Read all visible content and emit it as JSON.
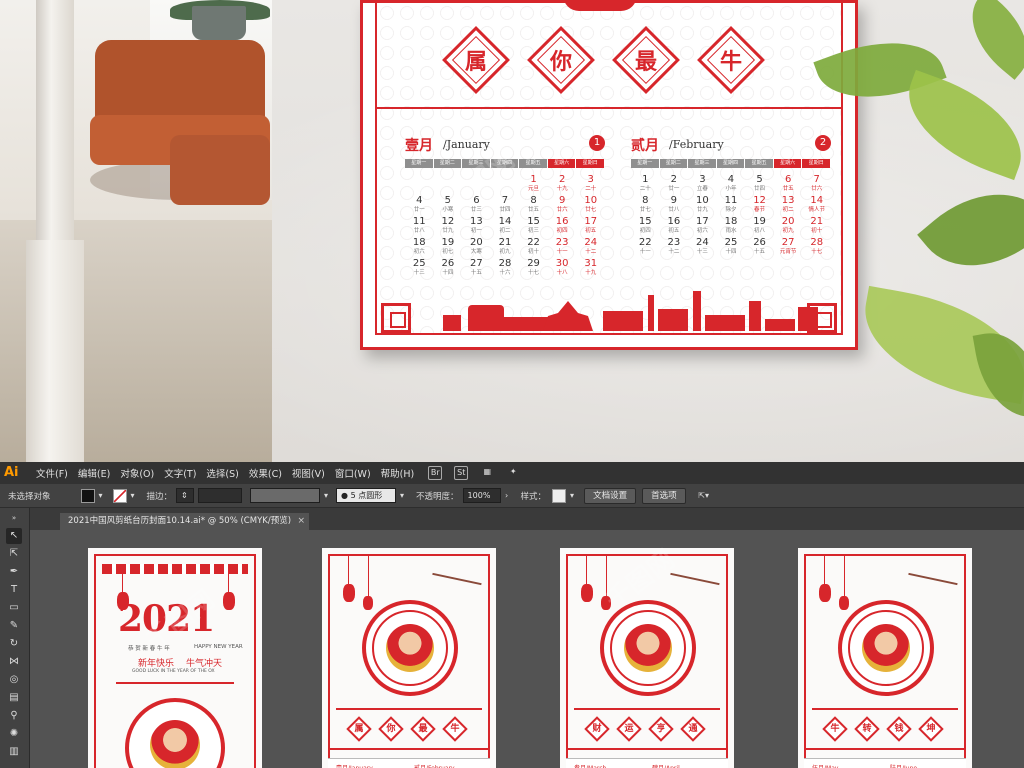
{
  "poster": {
    "tiles": [
      "属",
      "你",
      "最",
      "牛"
    ],
    "weekdays": [
      "星期一",
      "星期二",
      "星期三",
      "星期四",
      "星期五",
      "星期六",
      "星期日"
    ],
    "months": [
      {
        "cn": "壹月",
        "en": "/January",
        "num": "1",
        "days": [
          {
            "d": "",
            "l": ""
          },
          {
            "d": "",
            "l": ""
          },
          {
            "d": "",
            "l": ""
          },
          {
            "d": "",
            "l": ""
          },
          {
            "d": "1",
            "l": "元旦",
            "r": true
          },
          {
            "d": "2",
            "l": "十九",
            "r": true
          },
          {
            "d": "3",
            "l": "二十",
            "r": true
          },
          {
            "d": "4",
            "l": "廿一"
          },
          {
            "d": "5",
            "l": "小寒"
          },
          {
            "d": "6",
            "l": "廿三"
          },
          {
            "d": "7",
            "l": "廿四"
          },
          {
            "d": "8",
            "l": "廿五"
          },
          {
            "d": "9",
            "l": "廿六",
            "r": true
          },
          {
            "d": "10",
            "l": "廿七",
            "r": true
          },
          {
            "d": "11",
            "l": "廿八"
          },
          {
            "d": "12",
            "l": "廿九"
          },
          {
            "d": "13",
            "l": "初一"
          },
          {
            "d": "14",
            "l": "初二"
          },
          {
            "d": "15",
            "l": "初三"
          },
          {
            "d": "16",
            "l": "初四",
            "r": true
          },
          {
            "d": "17",
            "l": "初五",
            "r": true
          },
          {
            "d": "18",
            "l": "初六"
          },
          {
            "d": "19",
            "l": "初七"
          },
          {
            "d": "20",
            "l": "大寒"
          },
          {
            "d": "21",
            "l": "初九"
          },
          {
            "d": "22",
            "l": "初十"
          },
          {
            "d": "23",
            "l": "十一",
            "r": true
          },
          {
            "d": "24",
            "l": "十二",
            "r": true
          },
          {
            "d": "25",
            "l": "十三"
          },
          {
            "d": "26",
            "l": "十四"
          },
          {
            "d": "27",
            "l": "十五"
          },
          {
            "d": "28",
            "l": "十六"
          },
          {
            "d": "29",
            "l": "十七"
          },
          {
            "d": "30",
            "l": "十八",
            "r": true
          },
          {
            "d": "31",
            "l": "十九",
            "r": true
          }
        ]
      },
      {
        "cn": "贰月",
        "en": "/February",
        "num": "2",
        "days": [
          {
            "d": "1",
            "l": "二十"
          },
          {
            "d": "2",
            "l": "廿一"
          },
          {
            "d": "3",
            "l": "立春"
          },
          {
            "d": "4",
            "l": "小年"
          },
          {
            "d": "5",
            "l": "廿四"
          },
          {
            "d": "6",
            "l": "廿五",
            "r": true
          },
          {
            "d": "7",
            "l": "廿六",
            "r": true
          },
          {
            "d": "8",
            "l": "廿七"
          },
          {
            "d": "9",
            "l": "廿八"
          },
          {
            "d": "10",
            "l": "廿九"
          },
          {
            "d": "11",
            "l": "除夕"
          },
          {
            "d": "12",
            "l": "春节",
            "r": true
          },
          {
            "d": "13",
            "l": "初二",
            "r": true
          },
          {
            "d": "14",
            "l": "情人节",
            "r": true
          },
          {
            "d": "15",
            "l": "初四"
          },
          {
            "d": "16",
            "l": "初五"
          },
          {
            "d": "17",
            "l": "初六"
          },
          {
            "d": "18",
            "l": "雨水"
          },
          {
            "d": "19",
            "l": "初八"
          },
          {
            "d": "20",
            "l": "初九",
            "r": true
          },
          {
            "d": "21",
            "l": "初十",
            "r": true
          },
          {
            "d": "22",
            "l": "十一"
          },
          {
            "d": "23",
            "l": "十二"
          },
          {
            "d": "24",
            "l": "十三"
          },
          {
            "d": "25",
            "l": "十四"
          },
          {
            "d": "26",
            "l": "十五"
          },
          {
            "d": "27",
            "l": "元宵节",
            "r": true
          },
          {
            "d": "28",
            "l": "十七",
            "r": true
          }
        ]
      }
    ]
  },
  "menubar": {
    "logo": "Ai",
    "items": [
      "文件(F)",
      "编辑(E)",
      "对象(O)",
      "文字(T)",
      "选择(S)",
      "效果(C)",
      "视图(V)",
      "窗口(W)",
      "帮助(H)"
    ],
    "icons": [
      "Br",
      "St"
    ]
  },
  "controlbar": {
    "selection": "未选择对象",
    "stroke_label": "描边：",
    "brush": "5 点圆形",
    "opacity_label": "不透明度：",
    "opacity": "100%",
    "style_label": "样式：",
    "doc_settings": "文档设置",
    "preferences": "首选项"
  },
  "document": {
    "tab_title": "2021中国风剪纸台历封面10.14.ai* @ 50% (CMYK/预览)",
    "close": "×"
  },
  "artboards": {
    "cover": {
      "year": "2021",
      "greeting": "新年快乐",
      "slogan": "牛气冲天",
      "happy": "HAPPY NEW YEAR",
      "sub": "恭 贺 新 春 牛 年",
      "luck": "GOOD LUCK IN THE YEAR OF THE OX"
    },
    "pages": [
      {
        "tiles": [
          "属",
          "你",
          "最",
          "牛"
        ],
        "m1": "壹月/January",
        "m2": "贰月/February"
      },
      {
        "tiles": [
          "财",
          "运",
          "亨",
          "通"
        ],
        "m1": "叁月/March",
        "m2": "肆月/April"
      },
      {
        "tiles": [
          "牛",
          "转",
          "钱",
          "坤"
        ],
        "m1": "伍月/May",
        "m2": "陆月/June"
      }
    ]
  },
  "colors": {
    "accent": "#d7262b",
    "ui_dark": "#323232",
    "ui_mid": "#535353"
  }
}
